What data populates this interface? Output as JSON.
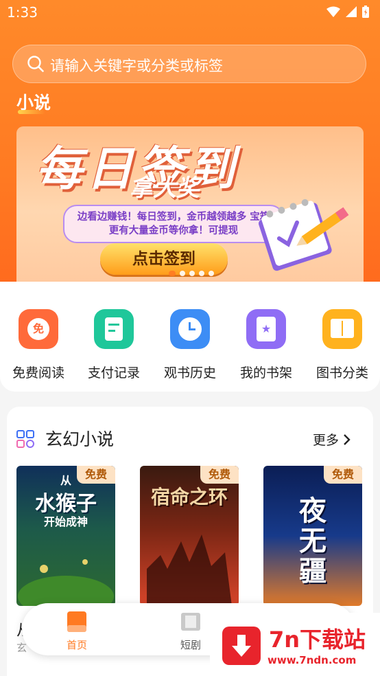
{
  "status_bar": {
    "time": "1:33"
  },
  "search": {
    "placeholder": "请输入关键字或分类或标签"
  },
  "section": {
    "title": "小说"
  },
  "banner": {
    "headline": "每日签到",
    "subhead": "拿大奖",
    "description": "边看边赚钱！每日签到，金币越领越多 宝箱更有大量金币等你拿！可提现",
    "cta": "点击签到",
    "pages": 5,
    "active_page": 1
  },
  "quick_actions": [
    {
      "label": "免费阅读",
      "icon": "free-read-icon",
      "glyph": "免",
      "color": "#ff6a3a"
    },
    {
      "label": "支付记录",
      "icon": "payment-record-icon",
      "color": "#1fc79a"
    },
    {
      "label": "观书历史",
      "icon": "history-clock-icon",
      "color": "#3d8df5"
    },
    {
      "label": "我的书架",
      "icon": "bookshelf-icon",
      "color": "#8f6df5"
    },
    {
      "label": "图书分类",
      "icon": "category-book-icon",
      "color": "#ffb21e"
    }
  ],
  "category": {
    "title": "玄幻小说",
    "more": "更多",
    "books": [
      {
        "badge": "免费",
        "cover_line1": "从",
        "cover_line2": "水猴子",
        "cover_line3": "开始成神"
      },
      {
        "badge": "免费",
        "cover_line1": "宿命之环",
        "cover_line2": "",
        "cover_line3": ""
      },
      {
        "badge": "免费",
        "cover_line1": "夜无疆",
        "cover_line2": "",
        "cover_line3": ""
      }
    ],
    "peek_title": "从",
    "peek_sub": "玄"
  },
  "tabbar": {
    "items": [
      {
        "label": "首页",
        "active": true
      },
      {
        "label": "短剧",
        "active": false
      }
    ],
    "active_color": "#ff7a22"
  },
  "watermark": {
    "title": "7n下载站",
    "url": "www.7ndn.com"
  }
}
